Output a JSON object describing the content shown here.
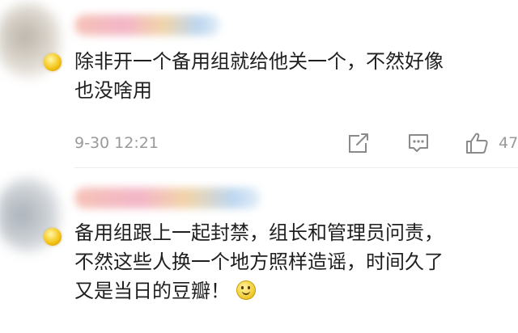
{
  "comments": [
    {
      "lines": [
        "除非开一个备用组就给他关一个，不然好像",
        "也没啥用"
      ],
      "time": "9-30 12:21",
      "like_count": "47"
    },
    {
      "lines": [
        "备用组跟上一起封禁，组长和管理员问责，",
        "不然这些人换一个地方照样造谣，时间久了",
        "又是当日的豆瓣！"
      ]
    }
  ],
  "icons": {
    "badge": "vip-badge-icon",
    "share": "share-icon",
    "reply": "comment-icon",
    "like": "thumbs-up-icon",
    "emoji": "smile-emoji-icon"
  },
  "colors": {
    "text": "#1f1f1f",
    "meta": "#9a9a9a",
    "divider": "#ececec"
  }
}
